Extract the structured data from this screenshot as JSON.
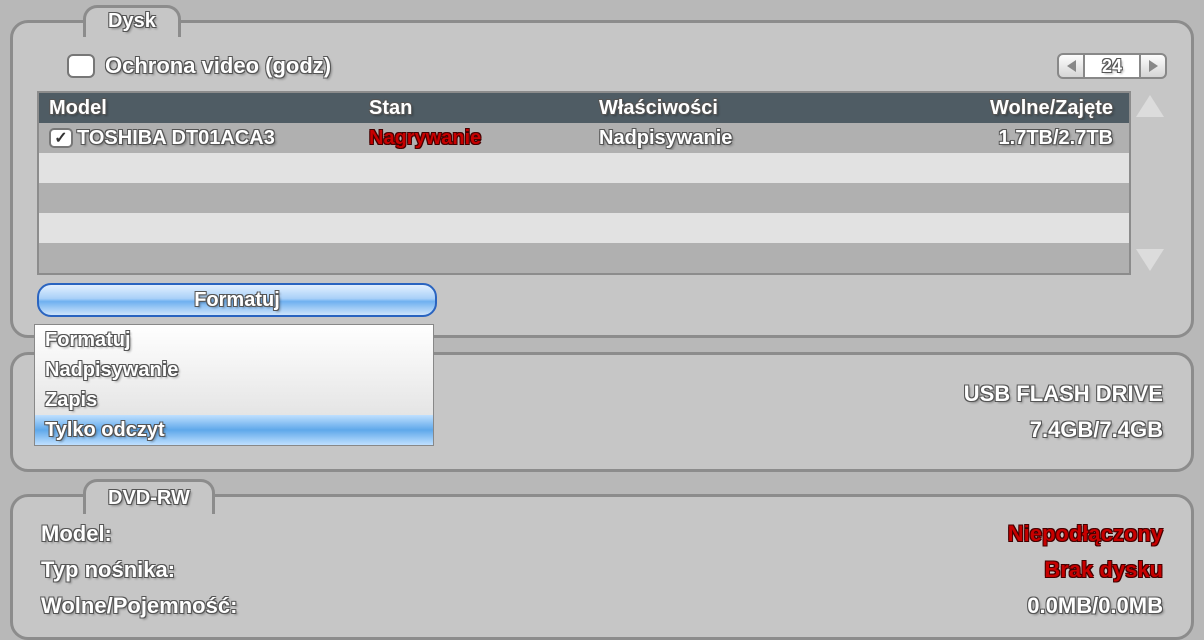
{
  "dysk": {
    "tab_label": "Dysk",
    "protection_label": "Ochrona video (godz)",
    "spinner_value": "24",
    "columns": {
      "model": "Model",
      "stan": "Stan",
      "wlas": "Właściwości",
      "wolne": "Wolne/Zajęte"
    },
    "rows": [
      {
        "checked": true,
        "model": "TOSHIBA DT01ACA3",
        "stan": "Nagrywanie",
        "wlas": "Nadpisywanie",
        "wolne": "1.7TB/2.7TB"
      }
    ],
    "format_button": "Formatuj",
    "dropdown": {
      "items": [
        "Formatuj",
        "Nadpisywanie",
        "Zapis",
        "Tylko odczyt"
      ],
      "selected_index": 3
    }
  },
  "usb": {
    "name": "USB FLASH DRIVE",
    "size": "7.4GB/7.4GB"
  },
  "dvd": {
    "tab_label": "DVD-RW",
    "model_label": "Model:",
    "model_value": "Niepodłączony",
    "type_label": "Typ nośnika:",
    "type_value": "Brak dysku",
    "free_label": "Wolne/Pojemność:",
    "free_value": "0.0MB/0.0MB"
  }
}
